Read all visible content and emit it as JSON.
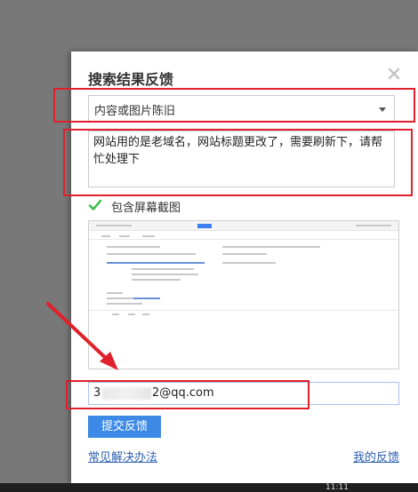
{
  "dialog": {
    "title": "搜索结果反馈",
    "close_icon": "close-icon"
  },
  "category_select": {
    "selected": "内容或图片陈旧"
  },
  "feedback_text": "网站用的是老域名，网站标题更改了，需要刷新下，请帮忙处理下",
  "screenshot_option": {
    "checked": true,
    "label": "包含屏幕截图"
  },
  "email": {
    "visible_prefix": "3",
    "visible_suffix": "2@qq.com"
  },
  "submit_label": "提交反馈",
  "links": {
    "faq": "常见解决办法",
    "my_feedback": "我的反馈"
  },
  "taskbar": {
    "clock": "11:11"
  },
  "colors": {
    "accent": "#3d8ae6",
    "annotation": "#e0202a",
    "check": "#2fbf3f"
  }
}
